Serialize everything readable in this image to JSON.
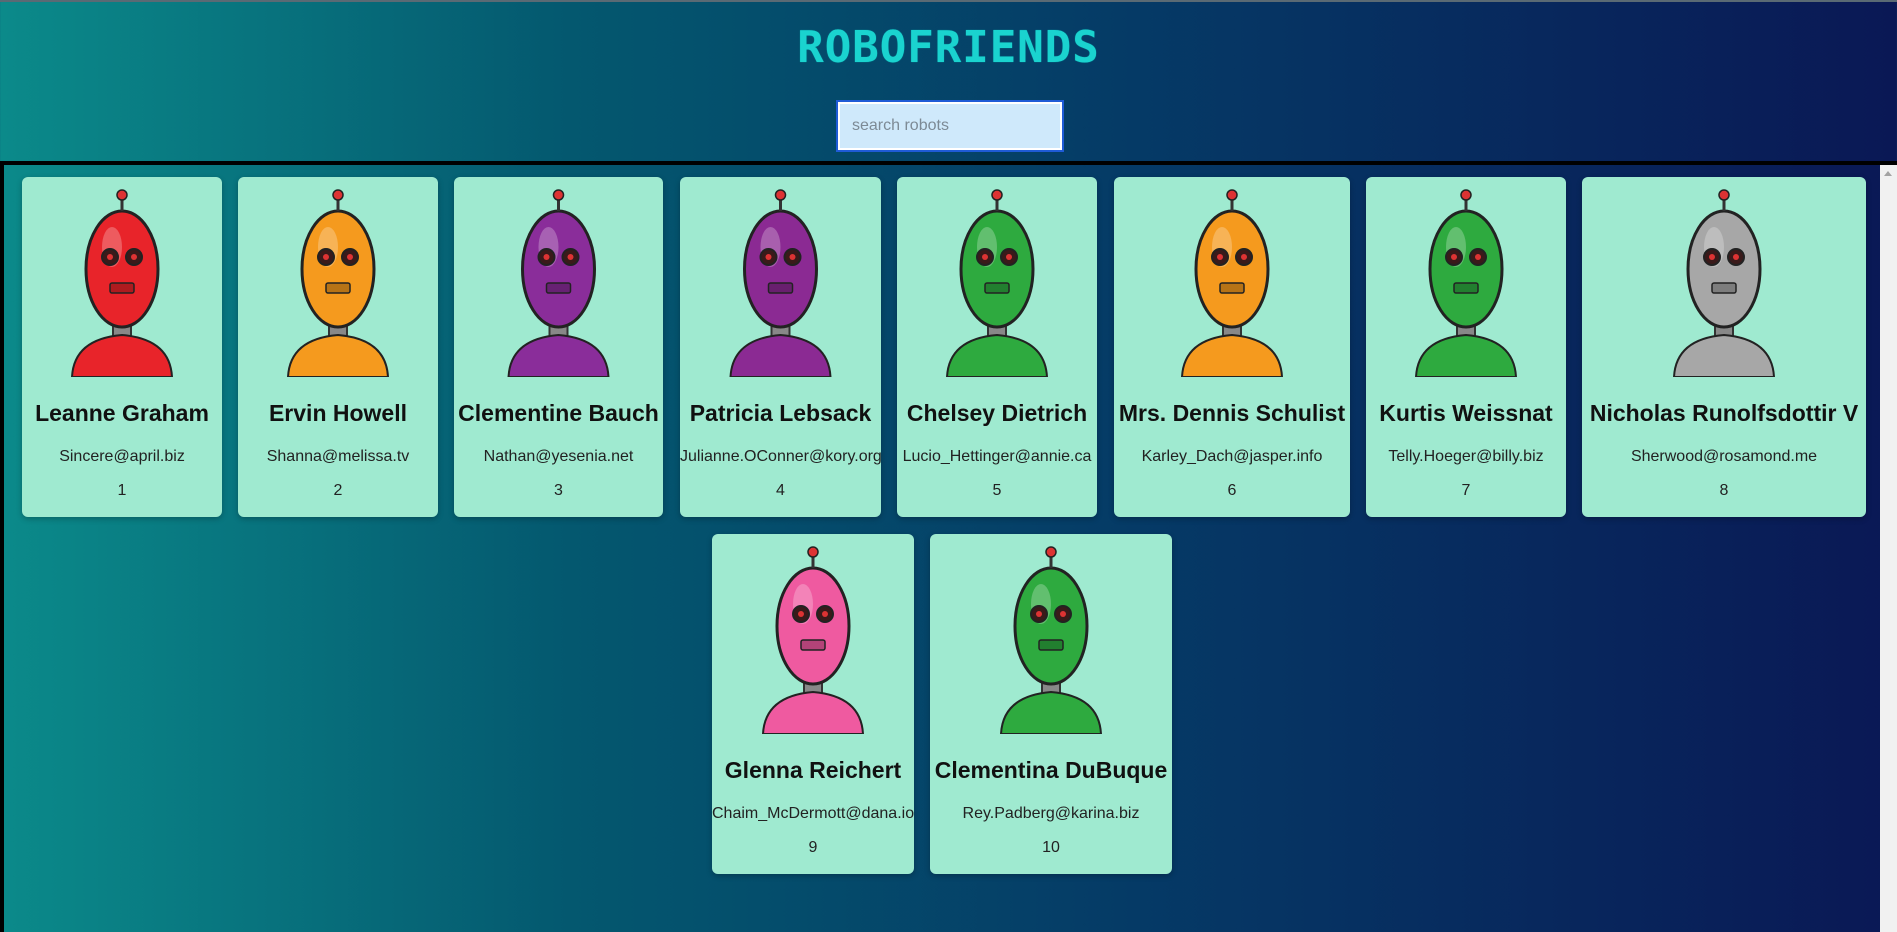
{
  "header": {
    "title": "ROBOFRIENDS"
  },
  "search": {
    "placeholder": "search robots",
    "value": ""
  },
  "robots": [
    {
      "name": "Leanne Graham",
      "email": "Sincere@april.biz",
      "id": "1",
      "color": "#e8242a"
    },
    {
      "name": "Ervin Howell",
      "email": "Shanna@melissa.tv",
      "id": "2",
      "color": "#f59a1e"
    },
    {
      "name": "Clementine Bauch",
      "email": "Nathan@yesenia.net",
      "id": "3",
      "color": "#8a2d9a"
    },
    {
      "name": "Patricia Lebsack",
      "email": "Julianne.OConner@kory.org",
      "id": "4",
      "color": "#8b2a93"
    },
    {
      "name": "Chelsey Dietrich",
      "email": "Lucio_Hettinger@annie.ca",
      "id": "5",
      "color": "#2eaa3f"
    },
    {
      "name": "Mrs. Dennis Schulist",
      "email": "Karley_Dach@jasper.info",
      "id": "6",
      "color": "#f59a1e"
    },
    {
      "name": "Kurtis Weissnat",
      "email": "Telly.Hoeger@billy.biz",
      "id": "7",
      "color": "#2eaa3f"
    },
    {
      "name": "Nicholas Runolfsdottir V",
      "email": "Sherwood@rosamond.me",
      "id": "8",
      "color": "#a7a7a7"
    },
    {
      "name": "Glenna Reichert",
      "email": "Chaim_McDermott@dana.io",
      "id": "9",
      "color": "#ef5aa0"
    },
    {
      "name": "Clementina DuBuque",
      "email": "Rey.Padberg@karina.biz",
      "id": "10",
      "color": "#2eaa3f"
    }
  ]
}
